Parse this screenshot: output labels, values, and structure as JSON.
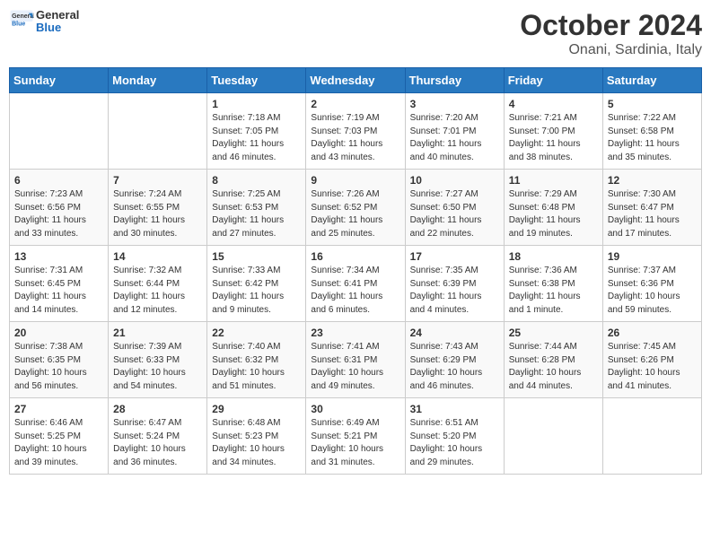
{
  "header": {
    "logo": {
      "general": "General",
      "blue": "Blue"
    },
    "title": "October 2024",
    "subtitle": "Onani, Sardinia, Italy"
  },
  "calendar": {
    "weekdays": [
      "Sunday",
      "Monday",
      "Tuesday",
      "Wednesday",
      "Thursday",
      "Friday",
      "Saturday"
    ],
    "weeks": [
      [
        {
          "day": null
        },
        {
          "day": null
        },
        {
          "day": "1",
          "sunrise": "Sunrise: 7:18 AM",
          "sunset": "Sunset: 7:05 PM",
          "daylight": "Daylight: 11 hours and 46 minutes."
        },
        {
          "day": "2",
          "sunrise": "Sunrise: 7:19 AM",
          "sunset": "Sunset: 7:03 PM",
          "daylight": "Daylight: 11 hours and 43 minutes."
        },
        {
          "day": "3",
          "sunrise": "Sunrise: 7:20 AM",
          "sunset": "Sunset: 7:01 PM",
          "daylight": "Daylight: 11 hours and 40 minutes."
        },
        {
          "day": "4",
          "sunrise": "Sunrise: 7:21 AM",
          "sunset": "Sunset: 7:00 PM",
          "daylight": "Daylight: 11 hours and 38 minutes."
        },
        {
          "day": "5",
          "sunrise": "Sunrise: 7:22 AM",
          "sunset": "Sunset: 6:58 PM",
          "daylight": "Daylight: 11 hours and 35 minutes."
        }
      ],
      [
        {
          "day": "6",
          "sunrise": "Sunrise: 7:23 AM",
          "sunset": "Sunset: 6:56 PM",
          "daylight": "Daylight: 11 hours and 33 minutes."
        },
        {
          "day": "7",
          "sunrise": "Sunrise: 7:24 AM",
          "sunset": "Sunset: 6:55 PM",
          "daylight": "Daylight: 11 hours and 30 minutes."
        },
        {
          "day": "8",
          "sunrise": "Sunrise: 7:25 AM",
          "sunset": "Sunset: 6:53 PM",
          "daylight": "Daylight: 11 hours and 27 minutes."
        },
        {
          "day": "9",
          "sunrise": "Sunrise: 7:26 AM",
          "sunset": "Sunset: 6:52 PM",
          "daylight": "Daylight: 11 hours and 25 minutes."
        },
        {
          "day": "10",
          "sunrise": "Sunrise: 7:27 AM",
          "sunset": "Sunset: 6:50 PM",
          "daylight": "Daylight: 11 hours and 22 minutes."
        },
        {
          "day": "11",
          "sunrise": "Sunrise: 7:29 AM",
          "sunset": "Sunset: 6:48 PM",
          "daylight": "Daylight: 11 hours and 19 minutes."
        },
        {
          "day": "12",
          "sunrise": "Sunrise: 7:30 AM",
          "sunset": "Sunset: 6:47 PM",
          "daylight": "Daylight: 11 hours and 17 minutes."
        }
      ],
      [
        {
          "day": "13",
          "sunrise": "Sunrise: 7:31 AM",
          "sunset": "Sunset: 6:45 PM",
          "daylight": "Daylight: 11 hours and 14 minutes."
        },
        {
          "day": "14",
          "sunrise": "Sunrise: 7:32 AM",
          "sunset": "Sunset: 6:44 PM",
          "daylight": "Daylight: 11 hours and 12 minutes."
        },
        {
          "day": "15",
          "sunrise": "Sunrise: 7:33 AM",
          "sunset": "Sunset: 6:42 PM",
          "daylight": "Daylight: 11 hours and 9 minutes."
        },
        {
          "day": "16",
          "sunrise": "Sunrise: 7:34 AM",
          "sunset": "Sunset: 6:41 PM",
          "daylight": "Daylight: 11 hours and 6 minutes."
        },
        {
          "day": "17",
          "sunrise": "Sunrise: 7:35 AM",
          "sunset": "Sunset: 6:39 PM",
          "daylight": "Daylight: 11 hours and 4 minutes."
        },
        {
          "day": "18",
          "sunrise": "Sunrise: 7:36 AM",
          "sunset": "Sunset: 6:38 PM",
          "daylight": "Daylight: 11 hours and 1 minute."
        },
        {
          "day": "19",
          "sunrise": "Sunrise: 7:37 AM",
          "sunset": "Sunset: 6:36 PM",
          "daylight": "Daylight: 10 hours and 59 minutes."
        }
      ],
      [
        {
          "day": "20",
          "sunrise": "Sunrise: 7:38 AM",
          "sunset": "Sunset: 6:35 PM",
          "daylight": "Daylight: 10 hours and 56 minutes."
        },
        {
          "day": "21",
          "sunrise": "Sunrise: 7:39 AM",
          "sunset": "Sunset: 6:33 PM",
          "daylight": "Daylight: 10 hours and 54 minutes."
        },
        {
          "day": "22",
          "sunrise": "Sunrise: 7:40 AM",
          "sunset": "Sunset: 6:32 PM",
          "daylight": "Daylight: 10 hours and 51 minutes."
        },
        {
          "day": "23",
          "sunrise": "Sunrise: 7:41 AM",
          "sunset": "Sunset: 6:31 PM",
          "daylight": "Daylight: 10 hours and 49 minutes."
        },
        {
          "day": "24",
          "sunrise": "Sunrise: 7:43 AM",
          "sunset": "Sunset: 6:29 PM",
          "daylight": "Daylight: 10 hours and 46 minutes."
        },
        {
          "day": "25",
          "sunrise": "Sunrise: 7:44 AM",
          "sunset": "Sunset: 6:28 PM",
          "daylight": "Daylight: 10 hours and 44 minutes."
        },
        {
          "day": "26",
          "sunrise": "Sunrise: 7:45 AM",
          "sunset": "Sunset: 6:26 PM",
          "daylight": "Daylight: 10 hours and 41 minutes."
        }
      ],
      [
        {
          "day": "27",
          "sunrise": "Sunrise: 6:46 AM",
          "sunset": "Sunset: 5:25 PM",
          "daylight": "Daylight: 10 hours and 39 minutes."
        },
        {
          "day": "28",
          "sunrise": "Sunrise: 6:47 AM",
          "sunset": "Sunset: 5:24 PM",
          "daylight": "Daylight: 10 hours and 36 minutes."
        },
        {
          "day": "29",
          "sunrise": "Sunrise: 6:48 AM",
          "sunset": "Sunset: 5:23 PM",
          "daylight": "Daylight: 10 hours and 34 minutes."
        },
        {
          "day": "30",
          "sunrise": "Sunrise: 6:49 AM",
          "sunset": "Sunset: 5:21 PM",
          "daylight": "Daylight: 10 hours and 31 minutes."
        },
        {
          "day": "31",
          "sunrise": "Sunrise: 6:51 AM",
          "sunset": "Sunset: 5:20 PM",
          "daylight": "Daylight: 10 hours and 29 minutes."
        },
        {
          "day": null
        },
        {
          "day": null
        }
      ]
    ]
  }
}
